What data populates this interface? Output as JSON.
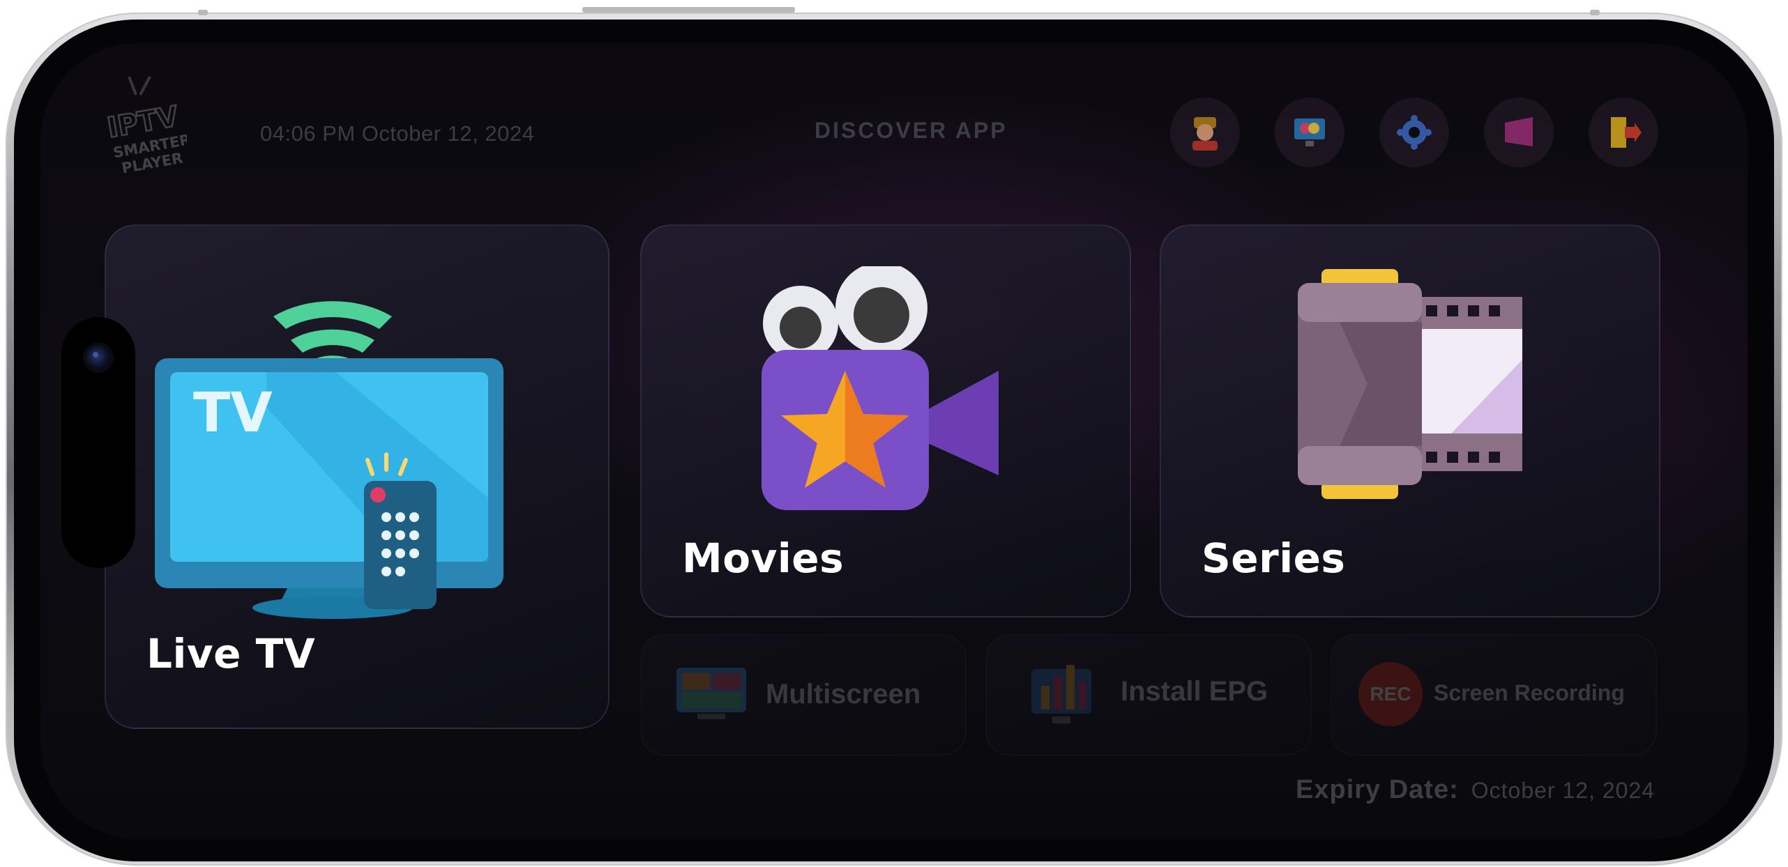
{
  "header": {
    "logo_text": "IPTV SMARTER PLAYER",
    "datetime": "04:06 PM October 12, 2024",
    "discover_label": "DISCOVER APP",
    "icons": [
      "profile-icon",
      "theme-icon",
      "settings-icon",
      "playlist-icon",
      "logout-icon"
    ]
  },
  "cards": {
    "live_tv": "Live TV",
    "live_tv_screen_text": "TV",
    "movies": "Movies",
    "series": "Series"
  },
  "tools": {
    "multiscreen": "Multiscreen",
    "install_epg": "Install EPG",
    "screen_recording": "Screen Recording",
    "rec_badge": "REC"
  },
  "footer": {
    "expiry_label": "Expiry Date:",
    "expiry_value": "October 12, 2024"
  },
  "colors": {
    "background": "#0c0a10",
    "card_border": "#5a5078",
    "tv_blue": "#2bb3e8",
    "wifi_green": "#4fd19a",
    "movie_purple": "#7b4fc8",
    "star_orange": "#f5a623",
    "film_mauve": "#8c7186",
    "film_gold": "#f3c33a"
  }
}
